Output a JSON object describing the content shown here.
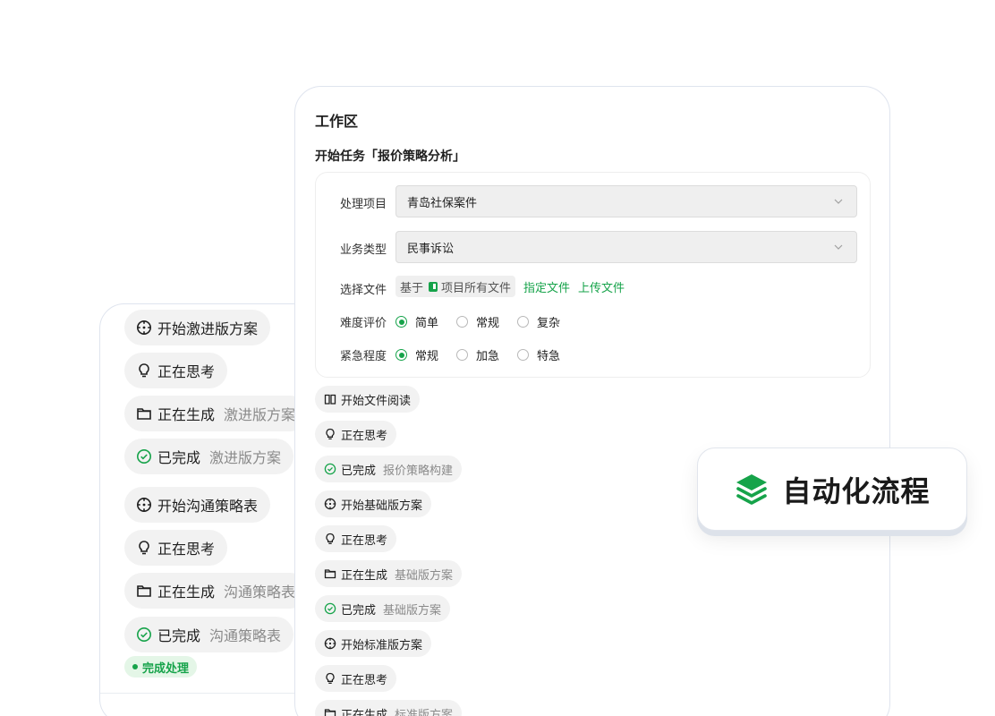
{
  "back_panel": {
    "items": [
      {
        "icon": "compass-icon",
        "label": "开始激进版方案",
        "sub": ""
      },
      {
        "icon": "bulb-icon",
        "label": "正在思考",
        "sub": ""
      },
      {
        "icon": "folder-icon",
        "label": "正在生成",
        "sub": "激进版方案"
      },
      {
        "icon": "check-circle-icon",
        "label": "已完成",
        "sub": "激进版方案"
      },
      {
        "icon": "compass-icon",
        "label": "开始沟通策略表",
        "sub": ""
      },
      {
        "icon": "bulb-icon",
        "label": "正在思考",
        "sub": ""
      },
      {
        "icon": "folder-icon",
        "label": "正在生成",
        "sub": "沟通策略表"
      },
      {
        "icon": "check-circle-icon",
        "label": "已完成",
        "sub": "沟通策略表"
      }
    ],
    "status_badge": "完成处理"
  },
  "workspace": {
    "title": "工作区",
    "task_title": "开始任务「报价策略分析」",
    "form": {
      "project_label": "处理项目",
      "project_value": "青岛社保案件",
      "type_label": "业务类型",
      "type_value": "民事诉讼",
      "file_label": "选择文件",
      "file_prefix": "基于",
      "file_tag": "项目所有文件",
      "file_link_specify": "指定文件",
      "file_link_upload": "上传文件",
      "difficulty_label": "难度评价",
      "difficulty_options": [
        "简单",
        "常规",
        "复杂"
      ],
      "difficulty_selected": "简单",
      "urgency_label": "紧急程度",
      "urgency_options": [
        "常规",
        "加急",
        "特急"
      ],
      "urgency_selected": "常规"
    },
    "steps": [
      {
        "icon": "book-icon",
        "label": "开始文件阅读",
        "sub": ""
      },
      {
        "icon": "bulb-icon",
        "label": "正在思考",
        "sub": ""
      },
      {
        "icon": "check-circle-icon",
        "label": "已完成",
        "sub": "报价策略构建"
      },
      {
        "icon": "compass-icon",
        "label": "开始基础版方案",
        "sub": ""
      },
      {
        "icon": "bulb-icon",
        "label": "正在思考",
        "sub": ""
      },
      {
        "icon": "folder-icon",
        "label": "正在生成",
        "sub": "基础版方案"
      },
      {
        "icon": "check-circle-icon",
        "label": "已完成",
        "sub": "基础版方案"
      },
      {
        "icon": "compass-icon",
        "label": "开始标准版方案",
        "sub": ""
      },
      {
        "icon": "bulb-icon",
        "label": "正在思考",
        "sub": ""
      },
      {
        "icon": "folder-icon",
        "label": "正在生成",
        "sub": "标准版方案"
      }
    ]
  },
  "floating_badge": {
    "icon": "layers-icon",
    "label": "自动化流程"
  },
  "colors": {
    "accent": "#16a34a",
    "chip_bg": "#f2f2f2",
    "sub_text": "#8a8a8a"
  }
}
